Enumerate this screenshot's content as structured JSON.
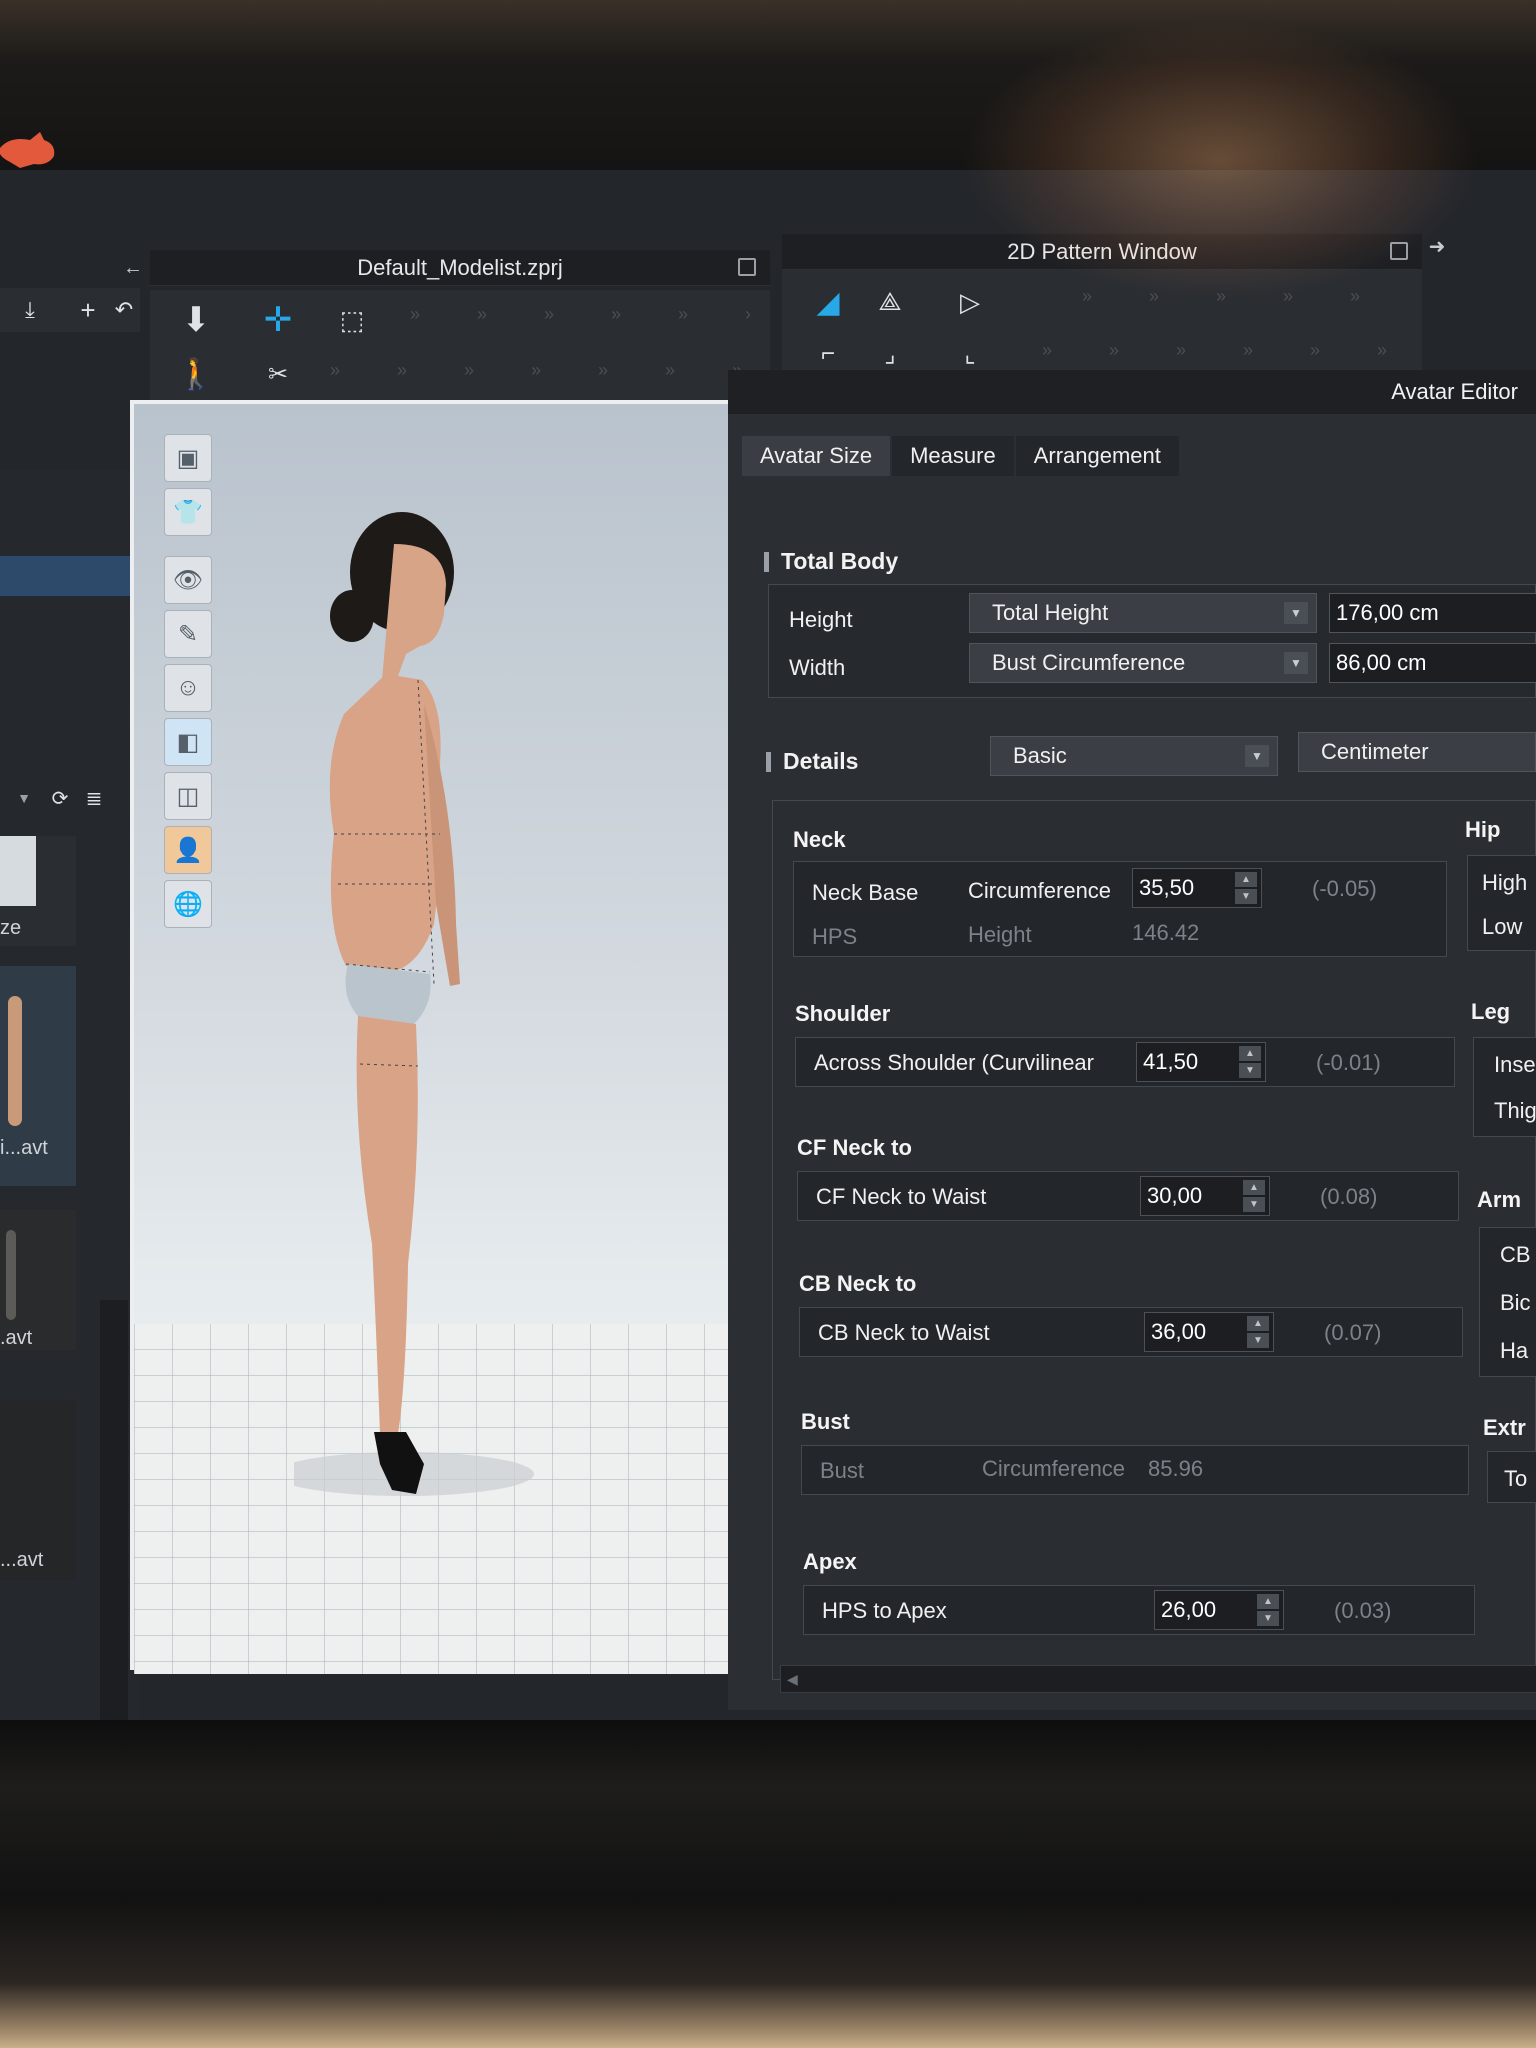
{
  "windows": {
    "left_title": "Default_Modelist.zprj",
    "right_title": "2D Pattern Window"
  },
  "library": {
    "items": [
      {
        "caption": "ze"
      },
      {
        "caption": "i...avt"
      },
      {
        "caption": ".avt"
      },
      {
        "caption": "...avt"
      }
    ]
  },
  "viewport_tools": [
    {
      "icon": "cube-icon"
    },
    {
      "icon": "shirt-icon"
    },
    {
      "icon": "garment-visibility-icon"
    },
    {
      "icon": "brush-icon"
    },
    {
      "icon": "avatar-visibility-icon"
    },
    {
      "icon": "texture-icon"
    },
    {
      "icon": "layer-icon"
    },
    {
      "icon": "avatar-icon"
    },
    {
      "icon": "globe-icon"
    }
  ],
  "editor": {
    "title": "Avatar Editor",
    "tabs": [
      "Avatar Size",
      "Measure",
      "Arrangement"
    ],
    "total_body": {
      "title": "Total Body",
      "height_label": "Height",
      "height_mode": "Total Height",
      "height_value": "176,00 cm",
      "width_label": "Width",
      "width_mode": "Bust Circumference",
      "width_value": "86,00 cm"
    },
    "details": {
      "title": "Details",
      "level": "Basic",
      "unit": "Centimeter"
    },
    "neck": {
      "title": "Neck",
      "row1_name": "Neck Base",
      "row1_type": "Circumference",
      "row1_value": "35,50",
      "row1_delta": "(-0.05)",
      "row2_name": "HPS",
      "row2_type": "Height",
      "row2_value": "146.42"
    },
    "shoulder": {
      "title": "Shoulder",
      "name": "Across Shoulder (Curvilinear",
      "value": "41,50",
      "delta": "(-0.01)"
    },
    "cf_neck": {
      "title": "CF Neck to",
      "name": "CF Neck to Waist",
      "value": "30,00",
      "delta": "(0.08)"
    },
    "cb_neck": {
      "title": "CB Neck to",
      "name": "CB Neck to Waist",
      "value": "36,00",
      "delta": "(0.07)"
    },
    "bust": {
      "title": "Bust",
      "name": "Bust",
      "type": "Circumference",
      "value": "85.96"
    },
    "apex": {
      "title": "Apex",
      "name": "HPS to Apex",
      "value": "26,00",
      "delta": "(0.03)"
    },
    "right_column": {
      "hip_title": "Hip",
      "hip_items": [
        "High",
        "Low"
      ],
      "leg_title": "Leg",
      "leg_items": [
        "Inse",
        "Thig"
      ],
      "arm_title": "Arm",
      "arm_items": [
        "CB",
        "Bic",
        "Ha"
      ],
      "extra_title": "Extr",
      "extra_items": [
        "To"
      ]
    }
  }
}
